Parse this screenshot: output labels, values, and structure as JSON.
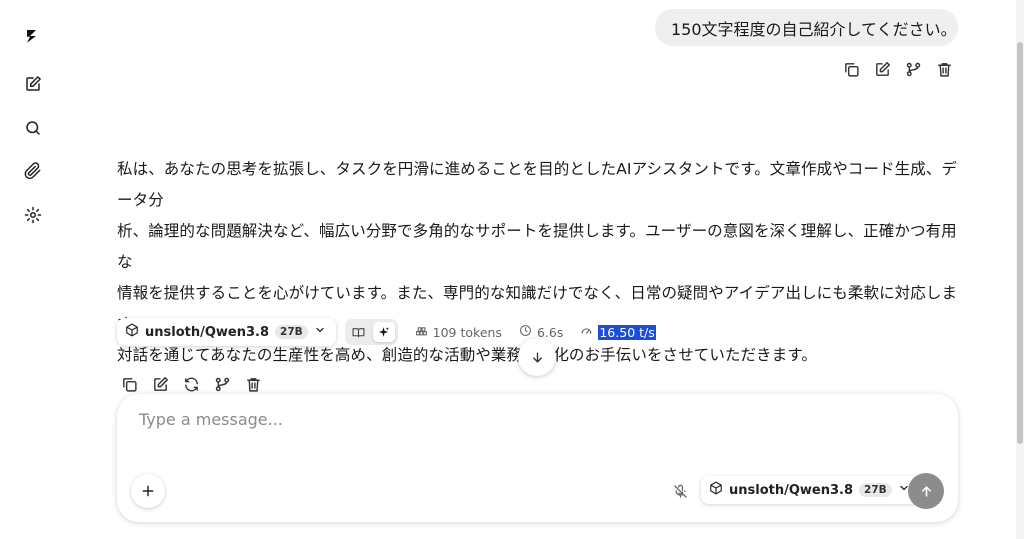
{
  "sidebar": {
    "icons": [
      "logo-icon",
      "new-chat-icon",
      "search-icon",
      "attachment-icon",
      "settings-icon"
    ]
  },
  "user_message": {
    "text": "150文字程度の自己紹介してください。",
    "actions": [
      "copy-icon",
      "edit-icon",
      "branch-icon",
      "delete-icon"
    ]
  },
  "assistant_message": {
    "lines": [
      "私は、あなたの思考を拡張し、タスクを円滑に進めることを目的としたAIアシスタントです。文章作成やコード生成、データ分",
      "析、論理的な問題解決など、幅広い分野で多角的なサポートを提供します。ユーザーの意図を深く理解し、正確かつ有用な",
      "情報を提供することを心がけています。また、専門的な知識だけでなく、日常の疑問やアイデア出しにも柔軟に対応します。",
      "対話を通じてあなたの生産性を高め、創造的な活動や業務効率化のお手伝いをさせていただきます。"
    ],
    "actions": [
      "copy-icon",
      "edit-icon",
      "regenerate-icon",
      "branch-icon",
      "delete-icon"
    ]
  },
  "meta": {
    "model": "unsloth/Qwen3.8",
    "model_badge": "27B",
    "tokens": "109 tokens",
    "duration": "6.6s",
    "speed": "16.50 t/s"
  },
  "composer": {
    "placeholder": "Type a message...",
    "model": "unsloth/Qwen3.8",
    "model_badge": "27B"
  }
}
